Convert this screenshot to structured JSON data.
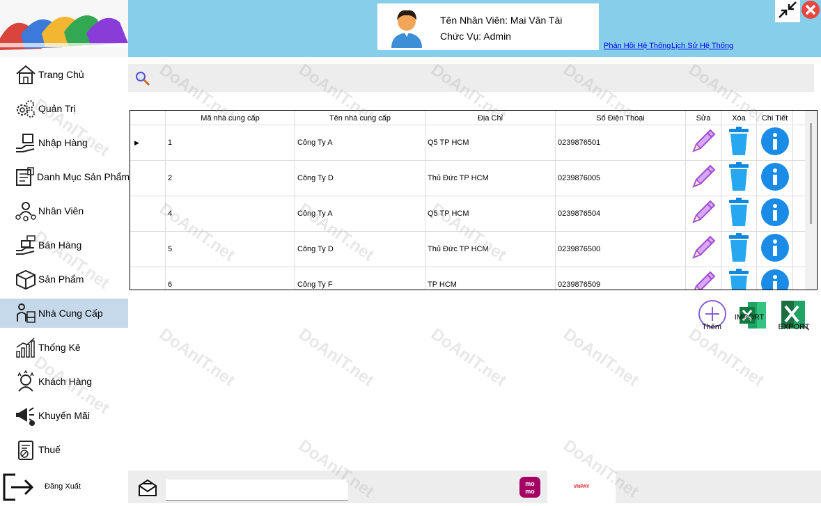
{
  "header": {
    "employee_name": "Tên Nhân Viên: Mai Văn Tài",
    "role": "Chức Vụ: Admin",
    "links": [
      "Phản Hồi Hệ Thống",
      "Lịch Sử Hệ Thống"
    ],
    "bg_color": "#87ceeb"
  },
  "sidebar": {
    "items": [
      {
        "label": "Trang Chủ",
        "icon": "home-icon"
      },
      {
        "label": "Quản Trị",
        "icon": "gears-icon"
      },
      {
        "label": "Nhập Hàng",
        "icon": "import-goods-icon"
      },
      {
        "label": "Danh Mục Sản Phẩm",
        "icon": "catalog-icon"
      },
      {
        "label": "Nhân Viên",
        "icon": "employees-icon"
      },
      {
        "label": "Bán Hàng",
        "icon": "sales-icon"
      },
      {
        "label": "Sản Phẩm",
        "icon": "box-icon"
      },
      {
        "label": "Nhà Cung Cấp",
        "icon": "supplier-icon"
      },
      {
        "label": "Thống Kê",
        "icon": "statistics-icon"
      },
      {
        "label": "Khách Hàng",
        "icon": "customer-icon"
      },
      {
        "label": "Khuyến Mãi",
        "icon": "megaphone-icon"
      },
      {
        "label": "Thuế",
        "icon": "tax-icon"
      }
    ],
    "active_index": 7,
    "active_color": "#c6d9ea",
    "logout": "Đăng Xuất"
  },
  "table": {
    "columns": [
      "Mã nhà cung cấp",
      "Tên nhà cung cấp",
      "Địa Chỉ",
      "Số Điện Thoại",
      "Sửa",
      "Xóa",
      "Chi Tiết"
    ],
    "rows": [
      {
        "id": "1",
        "name": "Công Ty A",
        "address": "Q5 TP HCM",
        "phone": "0239876501",
        "selected": true
      },
      {
        "id": "2",
        "name": "Công Ty D",
        "address": "Thủ Đức TP HCM",
        "phone": "0239876005",
        "selected": false
      },
      {
        "id": "4",
        "name": "Công Ty A",
        "address": "Q5 TP HCM",
        "phone": "0239876504",
        "selected": false
      },
      {
        "id": "5",
        "name": "Công Ty D",
        "address": "Thủ Đức TP HCM",
        "phone": "0239876500",
        "selected": false
      },
      {
        "id": "6",
        "name": "Công Ty F",
        "address": "TP HCM",
        "phone": "0239876509",
        "selected": false
      }
    ]
  },
  "actions": {
    "add": "Thêm",
    "import": "IMPORT",
    "export": "EXPORT"
  },
  "footer": {
    "momo": "mo mo",
    "vnpay": "VNPAY"
  },
  "watermark": "DoAnIT.net",
  "colors": {
    "accent_blue": "#1e90ff",
    "pencil_purple": "#b05ce0",
    "excel_green": "#1d6f42"
  }
}
